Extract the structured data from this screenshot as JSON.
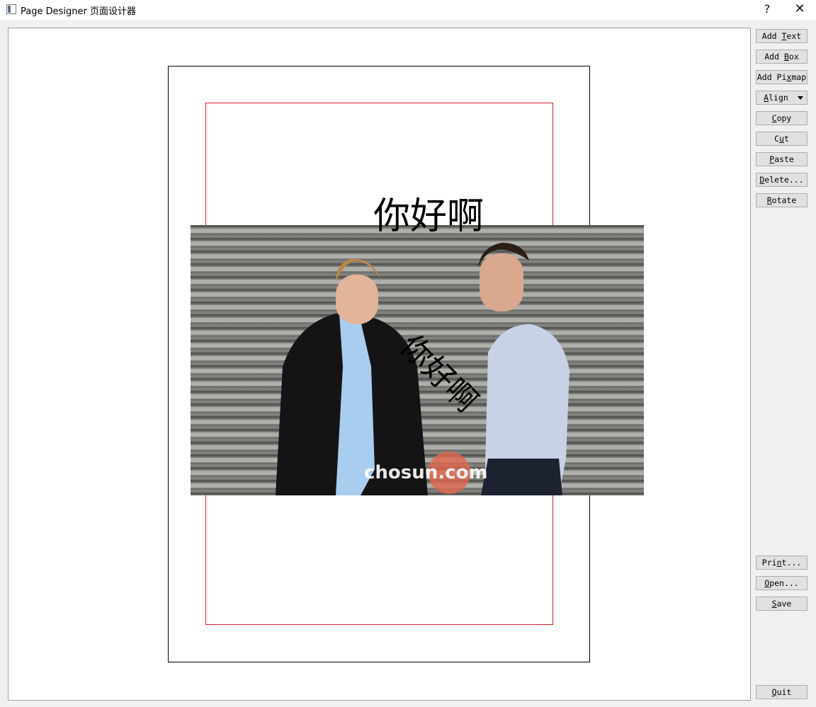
{
  "window": {
    "title": "Page Designer 页面设计器",
    "help_glyph": "?",
    "close_glyph": "✕",
    "app_icon": "window-icon"
  },
  "canvas": {
    "items": {
      "text_horizontal": "你好啊",
      "text_rotated": "你好啊",
      "pixmap": {
        "watermark": "chosun.com",
        "description_icon": "photo-two-men-on-stairs"
      }
    },
    "colors": {
      "page_border": "#000000",
      "margin_border": "#d4202a"
    }
  },
  "buttons_top": [
    {
      "id": "add-text",
      "pre": "Add ",
      "u": "T",
      "post": "ext"
    },
    {
      "id": "add-box",
      "pre": "Add ",
      "u": "B",
      "post": "ox"
    },
    {
      "id": "add-pixmap",
      "pre": "Add Pi",
      "u": "x",
      "post": "map"
    },
    {
      "id": "align",
      "pre": "",
      "u": "A",
      "post": "lign"
    },
    {
      "id": "copy",
      "pre": "",
      "u": "C",
      "post": "opy"
    },
    {
      "id": "cut",
      "pre": "C",
      "u": "u",
      "post": "t"
    },
    {
      "id": "paste",
      "pre": "",
      "u": "P",
      "post": "aste"
    },
    {
      "id": "delete",
      "pre": "",
      "u": "D",
      "post": "elete..."
    },
    {
      "id": "rotate",
      "pre": "",
      "u": "R",
      "post": "otate"
    }
  ],
  "buttons_bottom": [
    {
      "id": "print",
      "pre": "Pri",
      "u": "n",
      "post": "t..."
    },
    {
      "id": "open",
      "pre": "",
      "u": "O",
      "post": "pen..."
    },
    {
      "id": "save",
      "pre": "",
      "u": "S",
      "post": "ave"
    },
    {
      "id": "quit",
      "pre": "",
      "u": "Q",
      "post": "uit"
    }
  ]
}
